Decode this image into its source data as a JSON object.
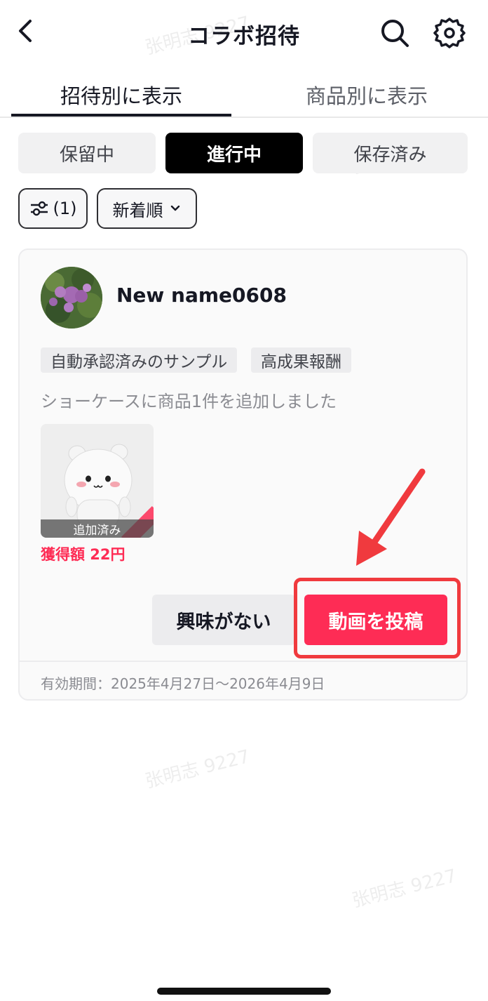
{
  "header": {
    "title": "コラボ招待",
    "back_icon": "chevron-left-icon",
    "search_icon": "search-icon",
    "settings_icon": "gear-icon"
  },
  "tabs": [
    {
      "label": "招待別に表示",
      "active": true
    },
    {
      "label": "商品別に表示",
      "active": false
    }
  ],
  "segments": [
    {
      "label": "保留中",
      "active": false
    },
    {
      "label": "進行中",
      "active": true
    },
    {
      "label": "保存済み",
      "active": false
    }
  ],
  "filters": {
    "filter_count": "(1)",
    "sort_label": "新着順"
  },
  "card": {
    "creator_name": "New name0608",
    "tags": [
      "自動承認済みのサンプル",
      "高成果報酬"
    ],
    "description": "ショーケースに商品1件を追加しました",
    "product": {
      "added_label": "追加済み",
      "earnings": "獲得額 22円"
    },
    "not_interested_label": "興味がない",
    "post_video_label": "動画を投稿",
    "validity": "有効期間：2025年4月27日～2026年4月9日"
  },
  "watermark": "张明志 9227",
  "colors": {
    "accent": "#fe2c55",
    "annotation": "#f03a3e",
    "active_segment": "#000000"
  }
}
